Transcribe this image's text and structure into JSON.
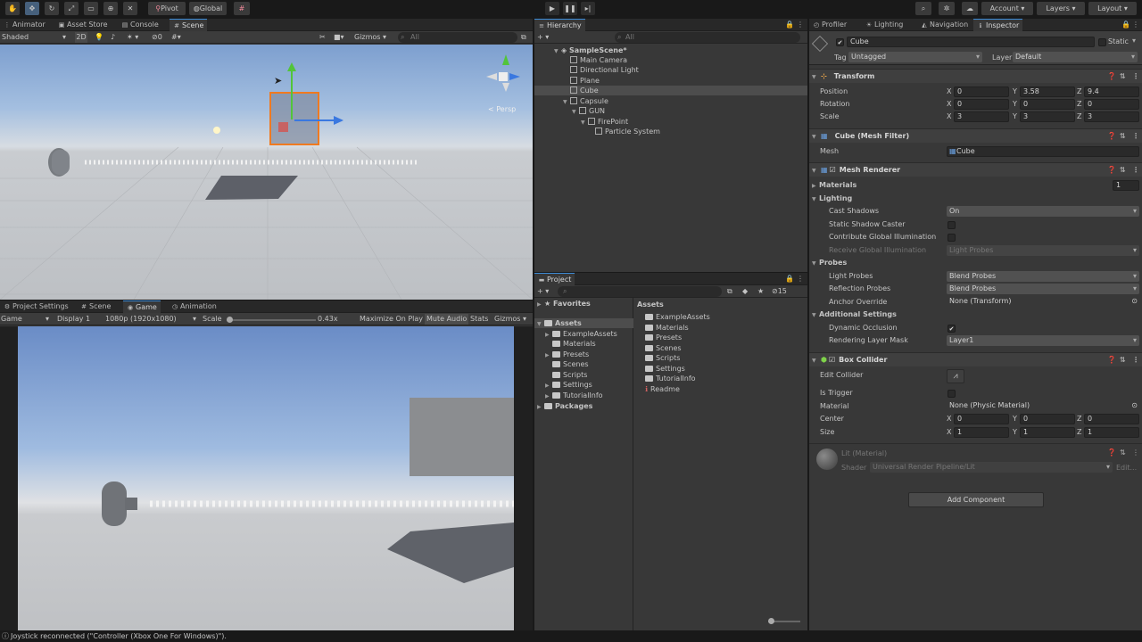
{
  "toolbar": {
    "pivot": "Pivot",
    "global": "Global",
    "account": "Account",
    "layers": "Layers",
    "layout": "Layout"
  },
  "scene_panel": {
    "tabs": [
      "Animator",
      "Asset Store",
      "Console",
      "Scene"
    ],
    "shading": "Shaded",
    "mode_2d": "2D",
    "hidden_count": "0",
    "gizmos": "Gizmos",
    "search_placeholder": "All",
    "persp": "< Persp"
  },
  "game_panel": {
    "tabs": [
      "Project Settings",
      "Scene",
      "Game",
      "Animation"
    ],
    "game_label": "Game",
    "display": "Display 1",
    "resolution": "1080p (1920x1080)",
    "scale_label": "Scale",
    "scale_value": "0.43x",
    "maximize": "Maximize On Play",
    "mute": "Mute Audio",
    "stats": "Stats",
    "gizmos": "Gizmos"
  },
  "hierarchy": {
    "title": "Hierarchy",
    "search_placeholder": "All",
    "items": [
      "SampleScene*",
      "Main Camera",
      "Directional Light",
      "Plane",
      "Cube",
      "Capsule",
      "GUN",
      "FirePoint",
      "Particle System"
    ]
  },
  "project": {
    "title": "Project",
    "hidden_count": "15",
    "favorites": "Favorites",
    "assets": "Assets",
    "packages": "Packages",
    "tree": [
      "ExampleAssets",
      "Materials",
      "Presets",
      "Scenes",
      "Scripts",
      "Settings",
      "TutorialInfo"
    ],
    "right_header": "Assets",
    "right_items": [
      "ExampleAssets",
      "Materials",
      "Presets",
      "Scenes",
      "Scripts",
      "Settings",
      "TutorialInfo",
      "Readme"
    ]
  },
  "inspector": {
    "tabs": [
      "Profiler",
      "Lighting",
      "Navigation",
      "Inspector"
    ],
    "object_name": "Cube",
    "static_label": "Static",
    "tag_label": "Tag",
    "tag_value": "Untagged",
    "layer_label": "Layer",
    "layer_value": "Default",
    "transform": {
      "title": "Transform",
      "position_label": "Position",
      "rotation_label": "Rotation",
      "scale_label": "Scale",
      "position": [
        "0",
        "3.58",
        "9.4"
      ],
      "rotation": [
        "0",
        "0",
        "0"
      ],
      "scale": [
        "3",
        "3",
        "3"
      ]
    },
    "axes": [
      "X",
      "Y",
      "Z"
    ],
    "mesh_filter": {
      "title": "Cube (Mesh Filter)",
      "mesh_label": "Mesh",
      "mesh_value": "Cube"
    },
    "mesh_renderer": {
      "title": "Mesh Renderer",
      "materials_label": "Materials",
      "materials_count": "1",
      "lighting_label": "Lighting",
      "cast_shadows_label": "Cast Shadows",
      "cast_shadows_value": "On",
      "static_shadow_label": "Static Shadow Caster",
      "contribute_gi_label": "Contribute Global Illumination",
      "receive_gi_label": "Receive Global Illumination",
      "receive_gi_value": "Light Probes",
      "probes_label": "Probes",
      "light_probes_label": "Light Probes",
      "light_probes_value": "Blend Probes",
      "reflection_probes_label": "Reflection Probes",
      "reflection_probes_value": "Blend Probes",
      "anchor_override_label": "Anchor Override",
      "anchor_override_value": "None (Transform)",
      "additional_label": "Additional Settings",
      "dynamic_occlusion_label": "Dynamic Occlusion",
      "rendering_layer_label": "Rendering Layer Mask",
      "rendering_layer_value": "Layer1"
    },
    "box_collider": {
      "title": "Box Collider",
      "edit_label": "Edit Collider",
      "trigger_label": "Is Trigger",
      "material_label": "Material",
      "material_value": "None (Physic Material)",
      "center_label": "Center",
      "center": [
        "0",
        "0",
        "0"
      ],
      "size_label": "Size",
      "size": [
        "1",
        "1",
        "1"
      ]
    },
    "material": {
      "title": "Lit (Material)",
      "shader_label": "Shader",
      "shader_value": "Universal Render Pipeline/Lit",
      "edit_label": "Edit..."
    },
    "add_component": "Add Component"
  },
  "status": {
    "message": "Joystick reconnected (\"Controller (Xbox One For Windows)\")."
  }
}
